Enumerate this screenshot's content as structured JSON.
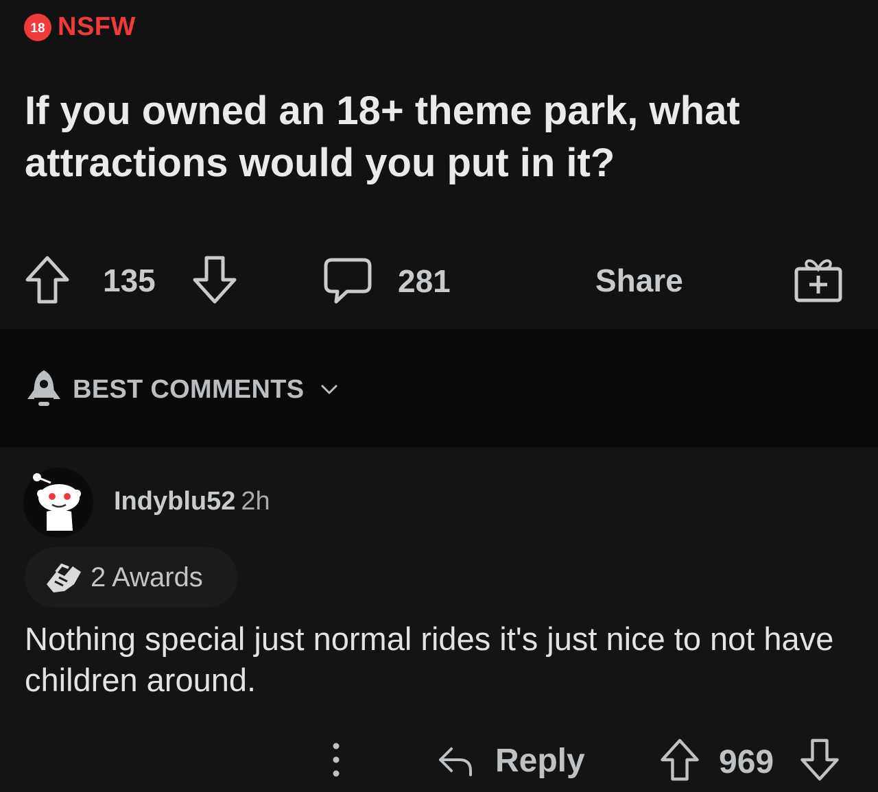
{
  "post": {
    "nsfw_badge": "18",
    "nsfw_label": "NSFW",
    "title": "If you owned an 18+ theme park, what attractions would you put in it?",
    "upvotes": "135",
    "comments": "281",
    "share_label": "Share"
  },
  "sort": {
    "label": "BEST COMMENTS"
  },
  "comment": {
    "author": "Indyblu52",
    "age": "2h",
    "awards_label": "2 Awards",
    "body": "Nothing special just normal rides it's just nice to not have children around.",
    "reply_label": "Reply",
    "score": "969"
  },
  "colors": {
    "background": "#121212",
    "nsfw": "#ef3b3b",
    "text": "#e8eaec",
    "muted": "#bcbfc2"
  },
  "icons": [
    "upvote-icon",
    "downvote-icon",
    "comment-icon",
    "gift-icon",
    "rocket-icon",
    "chevron-down-icon",
    "award-handshake-icon",
    "more-vertical-icon",
    "reply-icon",
    "avatar-snoo"
  ]
}
